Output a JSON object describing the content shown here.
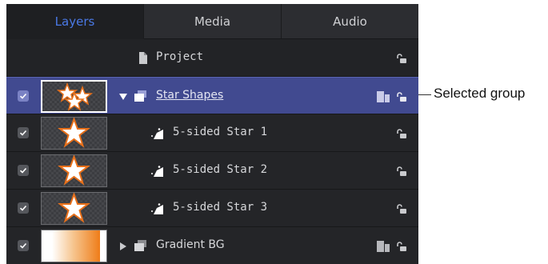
{
  "tabs": [
    {
      "label": "Layers",
      "active": true
    },
    {
      "label": "Media",
      "active": false
    },
    {
      "label": "Audio",
      "active": false
    }
  ],
  "project": {
    "label": "Project",
    "icon": "document-icon"
  },
  "layers": [
    {
      "label": "Star Shapes",
      "type": "group",
      "selected": true,
      "expanded": true,
      "checked": true,
      "thumbnail": "three-stars",
      "locked": false
    },
    {
      "label": "5-sided Star 1",
      "type": "shape",
      "selected": false,
      "checked": true,
      "thumbnail": "star",
      "locked": false
    },
    {
      "label": "5-sided Star 2",
      "type": "shape",
      "selected": false,
      "checked": true,
      "thumbnail": "star",
      "locked": false
    },
    {
      "label": "5-sided Star 3",
      "type": "shape",
      "selected": false,
      "checked": true,
      "thumbnail": "star",
      "locked": false
    },
    {
      "label": "Gradient BG",
      "type": "group",
      "selected": false,
      "expanded": false,
      "checked": true,
      "thumbnail": "gradient",
      "locked": false
    }
  ],
  "callout": {
    "label": "Selected group"
  },
  "colors": {
    "accent": "#4a79e6",
    "selected_row": "#414a90",
    "panel": "#222326",
    "star_fill": "#ffffff",
    "star_stroke": "#e8701a"
  }
}
